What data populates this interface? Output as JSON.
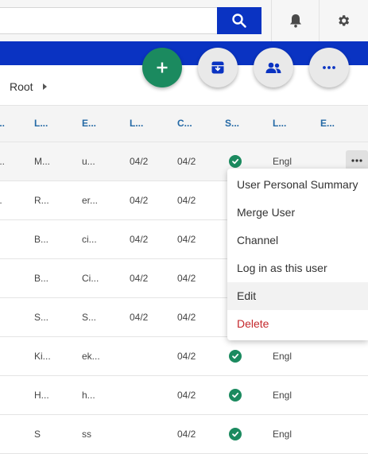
{
  "header": {
    "search_placeholder": "",
    "search_icon": "search-icon",
    "notification_icon": "bell-icon",
    "settings_icon": "gear-icon"
  },
  "actions": {
    "add_icon": "plus-icon",
    "archive_icon": "archive-icon",
    "users_icon": "users-icon",
    "more_icon": "more-horizontal-icon"
  },
  "breadcrumb": {
    "root_label": "Root"
  },
  "table": {
    "columns": [
      "...",
      "L...",
      "E...",
      "L...",
      "C...",
      "S...",
      "L...",
      "E..."
    ],
    "rows": [
      {
        "c0": "...",
        "c1": "M...",
        "c2": "u...",
        "c3": "04/2",
        "c4": "04/2",
        "c6": "Engl",
        "status": true
      },
      {
        "c0": "..",
        "c1": "R...",
        "c2": "er...",
        "c3": "04/2",
        "c4": "04/2",
        "c6": "",
        "status": false
      },
      {
        "c0": ".",
        "c1": "B...",
        "c2": "ci...",
        "c3": "04/2",
        "c4": "04/2",
        "c6": "",
        "status": false
      },
      {
        "c0": ".",
        "c1": "B...",
        "c2": "Ci...",
        "c3": "04/2",
        "c4": "04/2",
        "c6": "",
        "status": false
      },
      {
        "c0": ".",
        "c1": "S...",
        "c2": "S...",
        "c3": "04/2",
        "c4": "04/2",
        "c6": "",
        "status": false
      },
      {
        "c0": ".",
        "c1": "Ki...",
        "c2": "ek...",
        "c3": "",
        "c4": "04/2",
        "c6": "Engl",
        "status": true
      },
      {
        "c0": ".",
        "c1": "H...",
        "c2": "h...",
        "c3": "",
        "c4": "04/2",
        "c6": "Engl",
        "status": true
      },
      {
        "c0": ".",
        "c1": "S",
        "c2": "ss",
        "c3": "",
        "c4": "04/2",
        "c6": "Engl",
        "status": true
      }
    ]
  },
  "context_menu": {
    "items": [
      "User Personal Summary",
      "Merge User",
      "Channel",
      "Log in as this user",
      "Edit",
      "Delete"
    ]
  },
  "colors": {
    "primary_blue": "#0a33c2",
    "success_green": "#1b8a5f",
    "danger_red": "#c4282c",
    "link_blue": "#2469a5"
  }
}
